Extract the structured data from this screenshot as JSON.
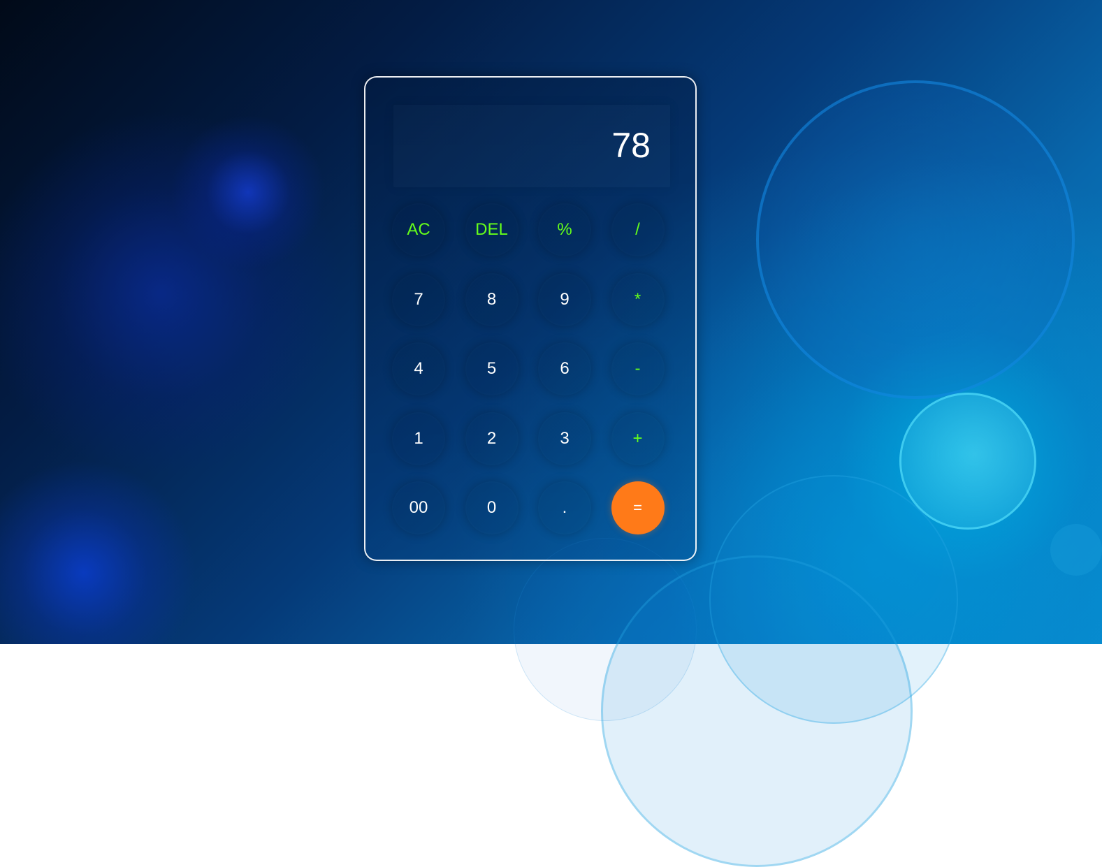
{
  "theme": {
    "accent_equals": "#ff7a18",
    "operator_color": "#66ff1a",
    "digit_color": "#ffffff",
    "panel_border": "#ffffff"
  },
  "calculator": {
    "display": "78",
    "keys": [
      {
        "label": "AC",
        "name": "clear-button",
        "kind": "op"
      },
      {
        "label": "DEL",
        "name": "delete-button",
        "kind": "op"
      },
      {
        "label": "%",
        "name": "percent-button",
        "kind": "op"
      },
      {
        "label": "/",
        "name": "divide-button",
        "kind": "op"
      },
      {
        "label": "7",
        "name": "digit-7-button",
        "kind": "digit"
      },
      {
        "label": "8",
        "name": "digit-8-button",
        "kind": "digit"
      },
      {
        "label": "9",
        "name": "digit-9-button",
        "kind": "digit"
      },
      {
        "label": "*",
        "name": "multiply-button",
        "kind": "op"
      },
      {
        "label": "4",
        "name": "digit-4-button",
        "kind": "digit"
      },
      {
        "label": "5",
        "name": "digit-5-button",
        "kind": "digit"
      },
      {
        "label": "6",
        "name": "digit-6-button",
        "kind": "digit"
      },
      {
        "label": "-",
        "name": "subtract-button",
        "kind": "op"
      },
      {
        "label": "1",
        "name": "digit-1-button",
        "kind": "digit"
      },
      {
        "label": "2",
        "name": "digit-2-button",
        "kind": "digit"
      },
      {
        "label": "3",
        "name": "digit-3-button",
        "kind": "digit"
      },
      {
        "label": "+",
        "name": "add-button",
        "kind": "op"
      },
      {
        "label": "00",
        "name": "double-zero-button",
        "kind": "digit"
      },
      {
        "label": "0",
        "name": "digit-0-button",
        "kind": "digit"
      },
      {
        "label": ".",
        "name": "decimal-button",
        "kind": "digit"
      },
      {
        "label": "=",
        "name": "equals-button",
        "kind": "equals"
      }
    ]
  }
}
